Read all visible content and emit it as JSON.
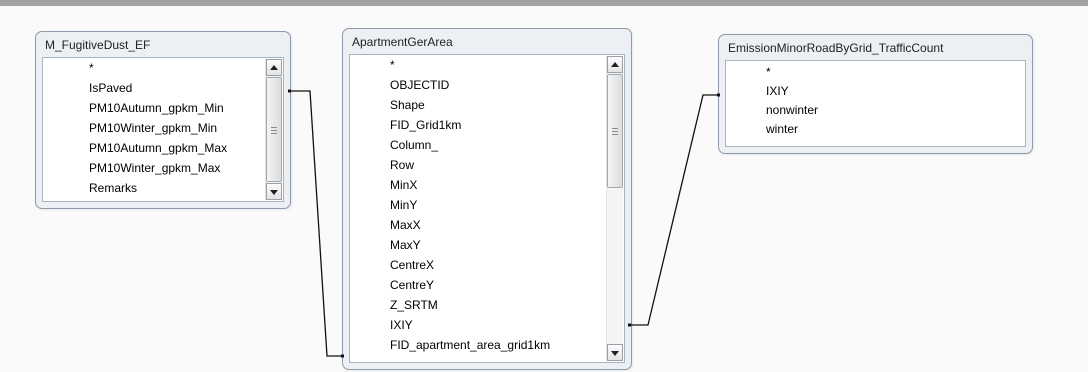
{
  "tables": [
    {
      "title": "M_FugitiveDust_EF",
      "fields": [
        "*",
        "IsPaved",
        "PM10Autumn_gpkm_Min",
        "PM10Winter_gpkm_Min",
        "PM10Autumn_gpkm_Max",
        "PM10Winter_gpkm_Max",
        "Remarks"
      ],
      "scrollbar": true
    },
    {
      "title": "ApartmentGerArea",
      "fields": [
        "*",
        "OBJECTID",
        "Shape",
        "FID_Grid1km",
        "Column_",
        "Row",
        "MinX",
        "MinY",
        "MaxX",
        "MaxY",
        "CentreX",
        "CentreY",
        "Z_SRTM",
        "IXIY",
        "FID_apartment_area_grid1km"
      ],
      "scrollbar": true
    },
    {
      "title": "EmissionMinorRoadByGrid_TrafficCount",
      "fields": [
        "*",
        "IXIY",
        "nonwinter",
        "winter"
      ],
      "scrollbar": false
    }
  ],
  "relationships": [
    {
      "from_table": "M_FugitiveDust_EF",
      "to_table": "ApartmentGerArea",
      "cardinality": "one-to-one"
    },
    {
      "from_table": "ApartmentGerArea",
      "from_field": "IXIY",
      "to_table": "EmissionMinorRoadByGrid_TrafficCount",
      "to_field": "IXIY",
      "cardinality": "one-to-one"
    }
  ],
  "colors": {
    "window_bg": "#fafafa",
    "table_frame": "#eceff3",
    "table_border": "#8e9aa9",
    "list_bg": "#ffffff",
    "link_line": "#111111"
  }
}
